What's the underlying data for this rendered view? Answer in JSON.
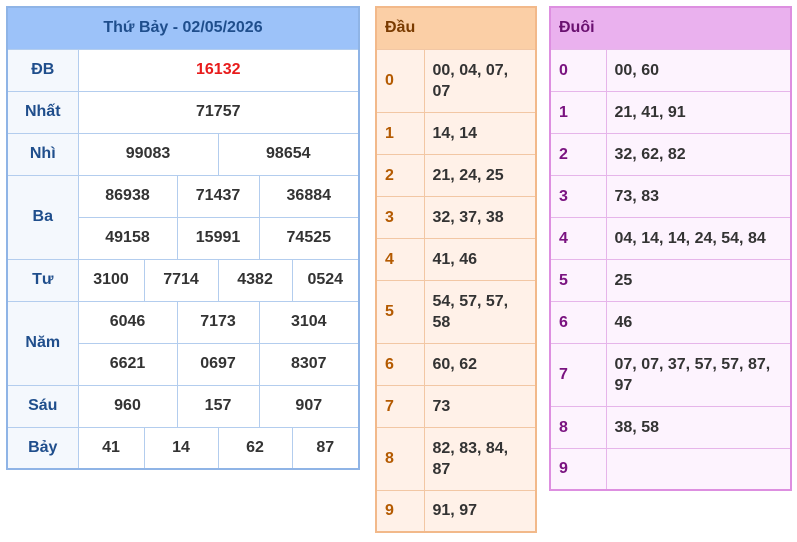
{
  "results": {
    "title": "Thứ Bảy - 02/05/2026",
    "labels": {
      "db": "ĐB",
      "nhat": "Nhất",
      "nhi": "Nhì",
      "ba": "Ba",
      "tu": "Tư",
      "nam": "Năm",
      "sau": "Sáu",
      "bay": "Bảy"
    },
    "db": [
      "16132"
    ],
    "nhat": [
      "71757"
    ],
    "nhi": [
      "99083",
      "98654"
    ],
    "ba": [
      "86938",
      "71437",
      "36884",
      "49158",
      "15991",
      "74525"
    ],
    "tu": [
      "3100",
      "7714",
      "4382",
      "0524"
    ],
    "nam": [
      "6046",
      "7173",
      "3104",
      "6621",
      "0697",
      "8307"
    ],
    "sau": [
      "960",
      "157",
      "907"
    ],
    "bay": [
      "41",
      "14",
      "62",
      "87"
    ],
    "colors": {
      "special": "#e81c1c",
      "label": "#1f4e8c"
    }
  },
  "dau": {
    "header": "Đầu",
    "rows": [
      {
        "key": "0",
        "value": "00, 04, 07, 07"
      },
      {
        "key": "1",
        "value": "14, 14"
      },
      {
        "key": "2",
        "value": "21, 24, 25"
      },
      {
        "key": "3",
        "value": "32, 37, 38"
      },
      {
        "key": "4",
        "value": "41, 46"
      },
      {
        "key": "5",
        "value": "54, 57, 57, 58"
      },
      {
        "key": "6",
        "value": "60, 62"
      },
      {
        "key": "7",
        "value": "73"
      },
      {
        "key": "8",
        "value": "82, 83, 84, 87"
      },
      {
        "key": "9",
        "value": "91, 97"
      }
    ]
  },
  "duoi": {
    "header": "Đuôi",
    "rows": [
      {
        "key": "0",
        "value": "00, 60"
      },
      {
        "key": "1",
        "value": "21, 41, 91"
      },
      {
        "key": "2",
        "value": "32, 62, 82"
      },
      {
        "key": "3",
        "value": "73, 83"
      },
      {
        "key": "4",
        "value": "04, 14, 14, 24, 54, 84"
      },
      {
        "key": "5",
        "value": "25"
      },
      {
        "key": "6",
        "value": "46"
      },
      {
        "key": "7",
        "value": "07, 07, 37, 57, 57, 87, 97"
      },
      {
        "key": "8",
        "value": "38, 58"
      },
      {
        "key": "9",
        "value": ""
      }
    ]
  }
}
